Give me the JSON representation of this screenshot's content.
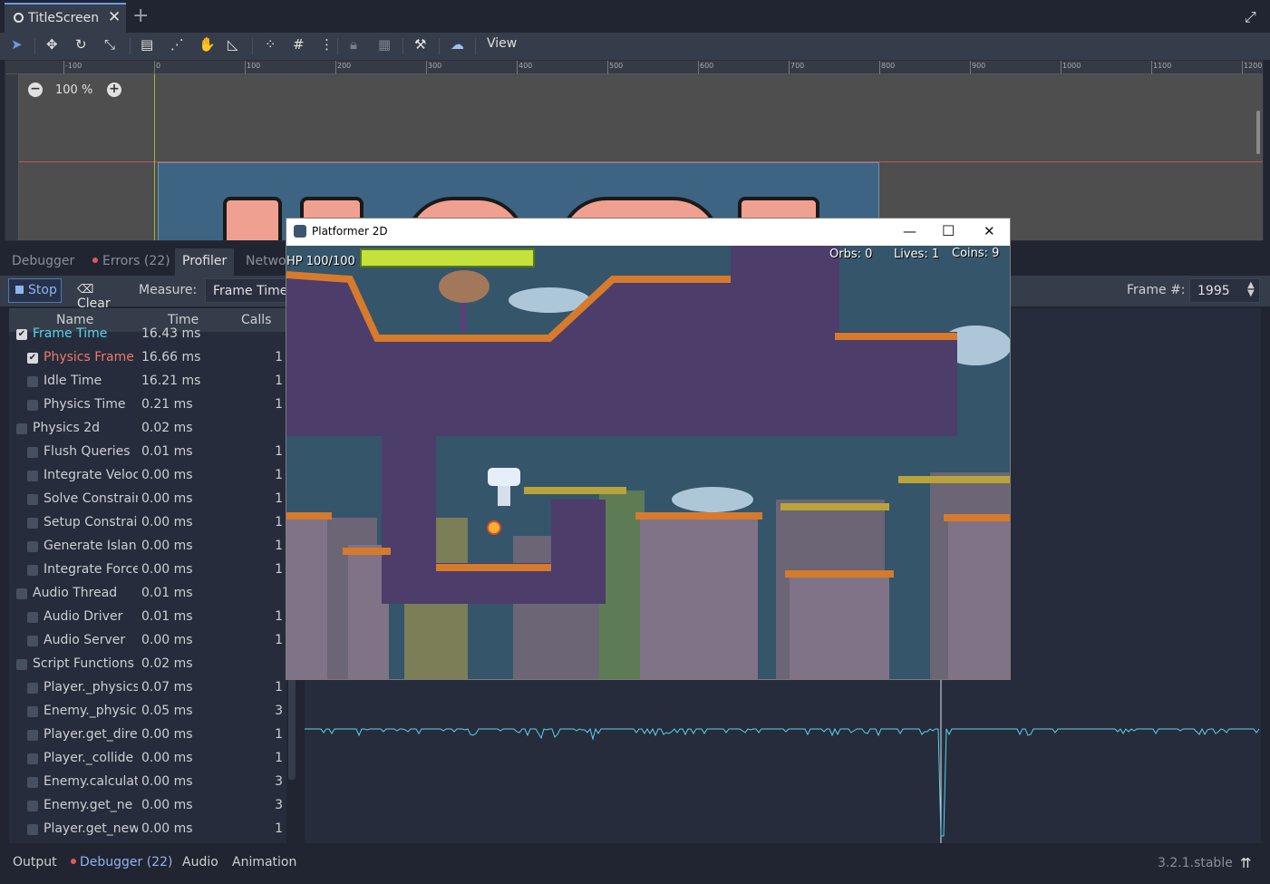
{
  "editor": {
    "scene_tab": "TitleScreen",
    "view_menu": "View",
    "zoom": "100 %",
    "ruler_labels": [
      "-100",
      "0",
      "100",
      "200",
      "300",
      "400",
      "500",
      "600",
      "700",
      "800",
      "900",
      "1000",
      "1100",
      "1200"
    ]
  },
  "debugger": {
    "tabs": [
      "Debugger",
      "Errors (22)",
      "Profiler",
      "Netwo"
    ],
    "active_tab": "Profiler",
    "stop_label": "Stop",
    "clear_label": "Clear",
    "measure_label": "Measure:",
    "measure_value": "Frame Time",
    "frame_label": "Frame #:",
    "frame_value": "1995",
    "columns": {
      "name": "Name",
      "time": "Time",
      "calls": "Calls"
    },
    "rows": [
      {
        "name": "Frame Time",
        "time": "16.43 ms",
        "calls": "",
        "level": 0,
        "checked": true,
        "color": "#59d4e8"
      },
      {
        "name": "Physics Frame",
        "time": "16.66 ms",
        "calls": "1",
        "level": 1,
        "checked": true,
        "color": "#f07868"
      },
      {
        "name": "Idle Time",
        "time": "16.21 ms",
        "calls": "1",
        "level": 1,
        "checked": false
      },
      {
        "name": "Physics Time",
        "time": "0.21 ms",
        "calls": "1",
        "level": 1,
        "checked": false
      },
      {
        "name": "Physics 2d",
        "time": "0.02 ms",
        "calls": "",
        "level": 0,
        "checked": false
      },
      {
        "name": "Flush Queries",
        "time": "0.01 ms",
        "calls": "1",
        "level": 1,
        "checked": false
      },
      {
        "name": "Integrate Veloc",
        "time": "0.00 ms",
        "calls": "1",
        "level": 1,
        "checked": false
      },
      {
        "name": "Solve Constrain",
        "time": "0.00 ms",
        "calls": "1",
        "level": 1,
        "checked": false
      },
      {
        "name": "Setup Constrai",
        "time": "0.00 ms",
        "calls": "1",
        "level": 1,
        "checked": false
      },
      {
        "name": "Generate Islan",
        "time": "0.00 ms",
        "calls": "1",
        "level": 1,
        "checked": false
      },
      {
        "name": "Integrate Force",
        "time": "0.00 ms",
        "calls": "1",
        "level": 1,
        "checked": false
      },
      {
        "name": "Audio Thread",
        "time": "0.01 ms",
        "calls": "",
        "level": 0,
        "checked": false
      },
      {
        "name": "Audio Driver",
        "time": "0.01 ms",
        "calls": "1",
        "level": 1,
        "checked": false
      },
      {
        "name": "Audio Server",
        "time": "0.00 ms",
        "calls": "1",
        "level": 1,
        "checked": false
      },
      {
        "name": "Script Functions",
        "time": "0.02 ms",
        "calls": "",
        "level": 0,
        "checked": false
      },
      {
        "name": "Player._physics",
        "time": "0.07 ms",
        "calls": "1",
        "level": 1,
        "checked": false
      },
      {
        "name": "Enemy._physic",
        "time": "0.05 ms",
        "calls": "3",
        "level": 1,
        "checked": false
      },
      {
        "name": "Player.get_dire",
        "time": "0.00 ms",
        "calls": "1",
        "level": 1,
        "checked": false
      },
      {
        "name": "Player._collide",
        "time": "0.00 ms",
        "calls": "1",
        "level": 1,
        "checked": false
      },
      {
        "name": "Enemy.calculat",
        "time": "0.00 ms",
        "calls": "3",
        "level": 1,
        "checked": false
      },
      {
        "name": "Enemy.get_ne",
        "time": "0.00 ms",
        "calls": "3",
        "level": 1,
        "checked": false
      },
      {
        "name": "Player.get_new",
        "time": "0.00 ms",
        "calls": "1",
        "level": 1,
        "checked": false
      }
    ]
  },
  "bottom_bar": {
    "tabs": [
      "Output",
      "Debugger (22)",
      "Audio",
      "Animation"
    ],
    "version": "3.2.1.stable"
  },
  "game_window": {
    "title": "Platformer 2D",
    "hp": "HP 100/100",
    "hp_fraction": 1.0,
    "orbs": "Orbs: 0",
    "lives": "Lives: 1",
    "coins": "Coins: 9"
  },
  "colors": {
    "accent": "#699ce8",
    "frame_time": "#59d4e8",
    "physics_frame": "#f07868",
    "hp_bar": "#c5e23b"
  }
}
